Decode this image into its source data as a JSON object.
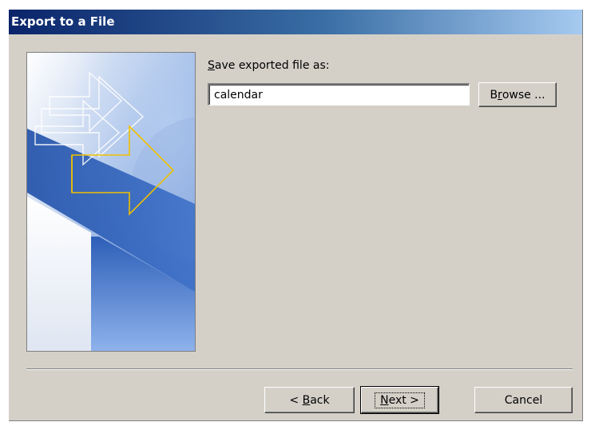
{
  "window": {
    "title": "Export to a File"
  },
  "form": {
    "label_prefix": "S",
    "label_rest": "ave exported file as:",
    "file_value": "calendar",
    "browse_prefix": "B",
    "browse_underlined": "r",
    "browse_rest": "owse ..."
  },
  "buttons": {
    "back_prefix": "< ",
    "back_underlined": "B",
    "back_rest": "ack",
    "next_underlined": "N",
    "next_rest": "ext >",
    "cancel_label": "Cancel"
  },
  "colors": {
    "title_gradient_start": "#0a246a",
    "title_gradient_end": "#a6caf0",
    "dialog_background": "#d4d0c8",
    "arrow_outline": "#f0c000"
  }
}
